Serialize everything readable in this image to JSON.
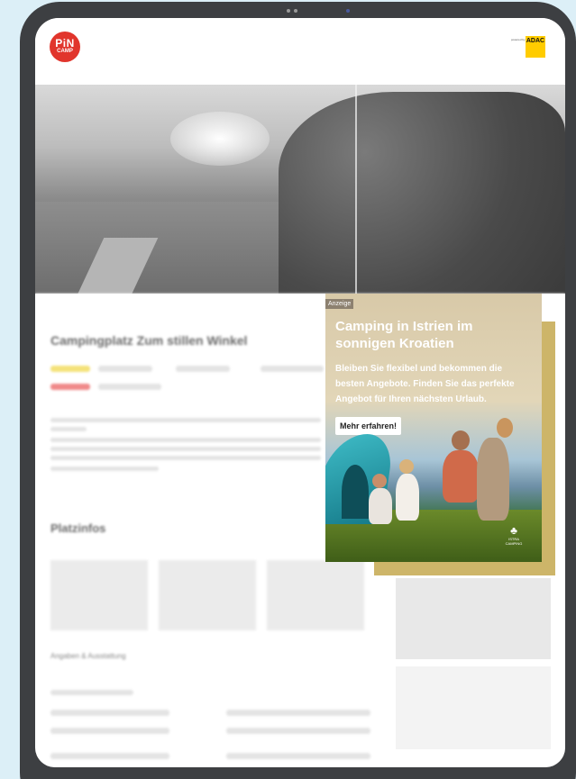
{
  "brand": {
    "pin_line1": "PiN",
    "pin_line2": "CAMP",
    "adac_powered": "powered by",
    "adac_label": "ADAC"
  },
  "page": {
    "title": "Campingplatz Zum stillen Winkel",
    "section_title": "Platzinfos",
    "sub_title": "Angaben & Ausstattung"
  },
  "ad": {
    "badge": "Anzeige",
    "headline": "Camping in Istrien im sonnigen Kroatien",
    "body": "Bleiben Sie flexibel und bekommen die besten Angebote. Finden Sie das perfekte Angebot für Ihren nächsten Urlaub.",
    "cta": "Mehr erfahren!",
    "logo_text": "ISTRA CAMPING"
  },
  "colors": {
    "page_bg": "#dceff7",
    "tablet_frame": "#3d3f42",
    "pin_red": "#e1352c",
    "adac_yellow": "#ffcc00",
    "ad_shadow": "#cdb569"
  },
  "icons": [
    "pin-camp-logo",
    "adac-logo",
    "istra-camping-logo"
  ]
}
